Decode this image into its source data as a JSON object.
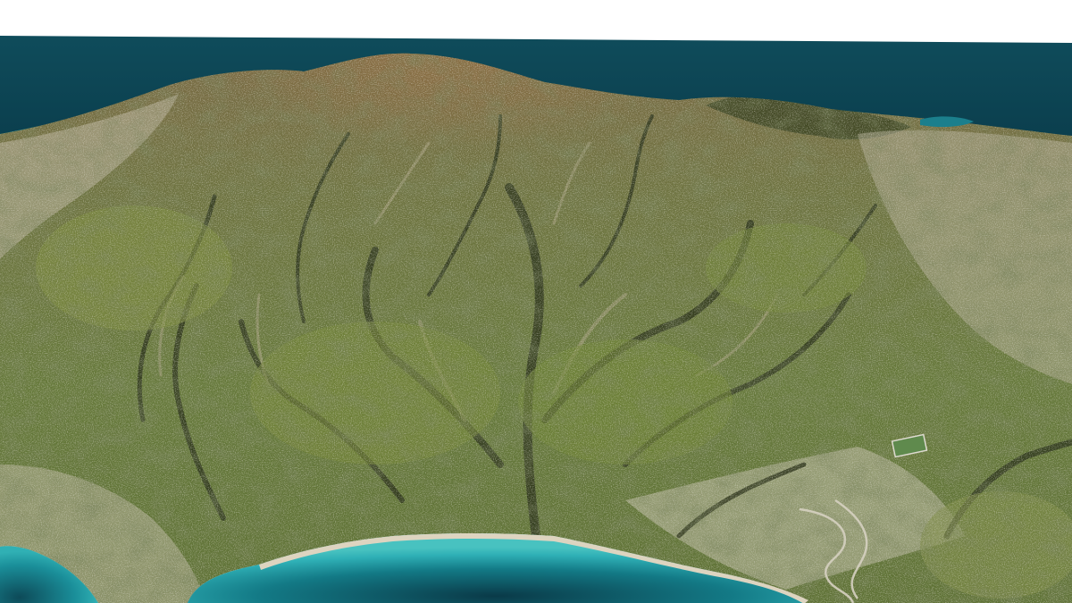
{
  "scene": {
    "subject": "aerial-terrain-view",
    "colors": {
      "background": "#ffffff",
      "open_sea": "#0e4a59",
      "deep_bay": "#0b3f4e",
      "shallow_water": "#1f9aa6",
      "turquoise_shore": "#33b3b8",
      "beach_sand": "#d9d0bd",
      "terrain_green": "#6f7d3f",
      "terrain_dark": "#3f4a26",
      "summit_brown": "#8a6f47",
      "ridge_shadow": "#2b331a",
      "settlement_light": "#c9c4b3"
    }
  }
}
